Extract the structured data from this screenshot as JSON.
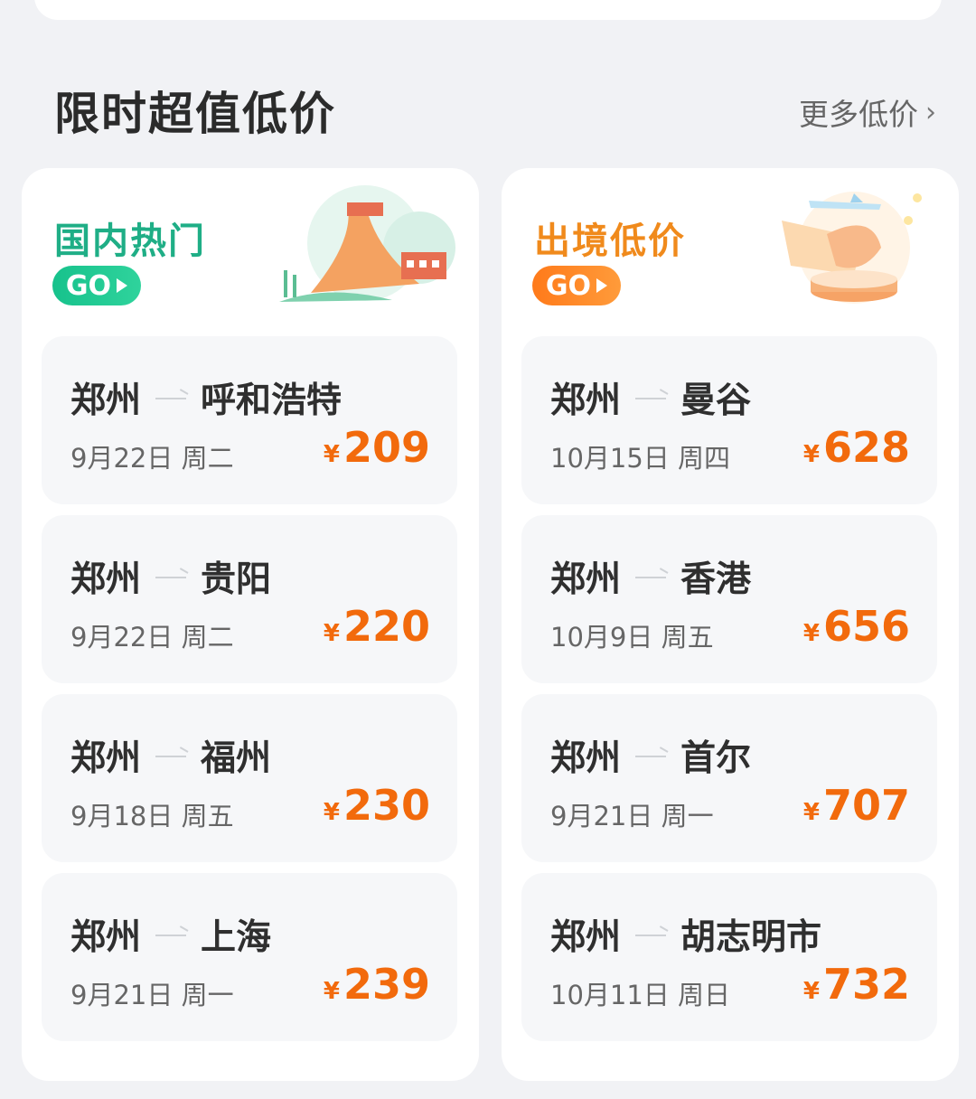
{
  "section": {
    "title": "限时超值低价",
    "more_label": "更多低价"
  },
  "panels": [
    {
      "title": "国内热门",
      "go_label": "GO",
      "accent": "#1fae86",
      "routes": [
        {
          "from": "郑州",
          "to": "呼和浩特",
          "date": "9月22日 周二",
          "currency": "¥",
          "price": "209"
        },
        {
          "from": "郑州",
          "to": "贵阳",
          "date": "9月22日 周二",
          "currency": "¥",
          "price": "220"
        },
        {
          "from": "郑州",
          "to": "福州",
          "date": "9月18日 周五",
          "currency": "¥",
          "price": "230"
        },
        {
          "from": "郑州",
          "to": "上海",
          "date": "9月21日 周一",
          "currency": "¥",
          "price": "239"
        }
      ]
    },
    {
      "title": "出境低价",
      "go_label": "GO",
      "accent": "#f08a1c",
      "routes": [
        {
          "from": "郑州",
          "to": "曼谷",
          "date": "10月15日 周四",
          "currency": "¥",
          "price": "628"
        },
        {
          "from": "郑州",
          "to": "香港",
          "date": "10月9日 周五",
          "currency": "¥",
          "price": "656"
        },
        {
          "from": "郑州",
          "to": "首尔",
          "date": "9月21日 周一",
          "currency": "¥",
          "price": "707"
        },
        {
          "from": "郑州",
          "to": "胡志明市",
          "date": "10月11日 周日",
          "currency": "¥",
          "price": "732"
        }
      ]
    }
  ],
  "colors": {
    "price": "#f26a0c",
    "background": "#f1f2f5"
  },
  "icons": {
    "domestic_illustration": "great-wall-icon",
    "international_illustration": "airplane-icon",
    "more_chevron": "chevron-right-icon"
  }
}
